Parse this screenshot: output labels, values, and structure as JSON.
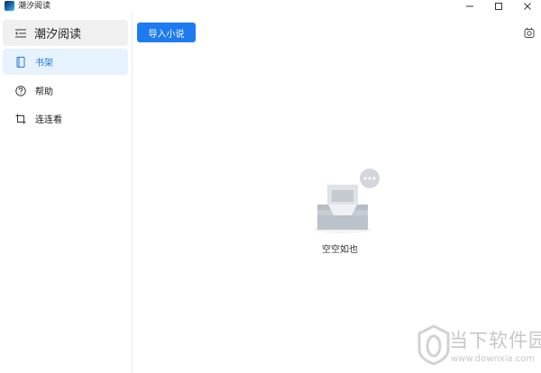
{
  "window": {
    "title": "潮汐阅读",
    "minimize_glyph": "—",
    "maximize_glyph": "□",
    "close_glyph": "✕"
  },
  "sidebar": {
    "header_label": "潮汐阅读",
    "items": [
      {
        "label": "书架",
        "icon": "book-icon",
        "active": true
      },
      {
        "label": "帮助",
        "icon": "help-icon",
        "active": false
      },
      {
        "label": "连连看",
        "icon": "crop-icon",
        "active": false
      }
    ]
  },
  "toolbar": {
    "import_label": "导入小说",
    "theme_icon": "theme-toggle-icon"
  },
  "empty_state": {
    "message": "空空如也",
    "illustration": "empty-inbox-icon"
  },
  "watermark": {
    "title": "当下软件园",
    "url": "www.downxia.com"
  },
  "colors": {
    "accent": "#1e7bef",
    "active_bg": "#e6f2fd",
    "active_text": "#2477d6",
    "header_bg": "#f0f0f0"
  }
}
